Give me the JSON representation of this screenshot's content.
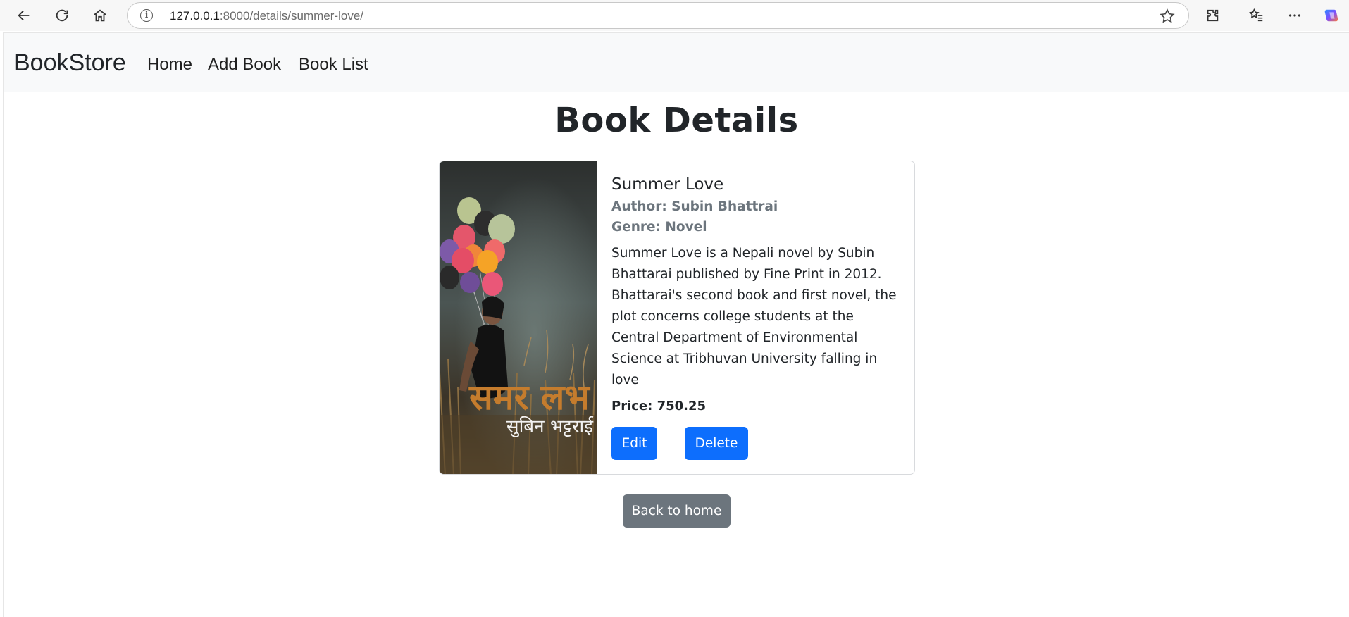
{
  "browser": {
    "url_host": "127.0.0.1",
    "url_path": ":8000/details/summer-love/"
  },
  "navbar": {
    "brand": "BookStore",
    "links": [
      "Home",
      "Add Book",
      "Book List"
    ]
  },
  "page": {
    "title": "Book Details"
  },
  "book": {
    "title": "Summer Love",
    "author": "Author: Subin Bhattrai",
    "genre": "Genre: Novel",
    "description": "Summer Love is a Nepali novel by Subin Bhattarai published by Fine Print in 2012. Bhattarai's second book and first novel, the plot concerns college students at the Central Department of Environmental Science at Tribhuvan University falling in love",
    "price": "Price: 750.25",
    "cover_title": "समर लभ",
    "cover_author": "सुबिन भट्टराई"
  },
  "actions": {
    "edit": "Edit",
    "delete": "Delete",
    "back": "Back to home"
  },
  "colors": {
    "primary": "#0d6efd",
    "secondary": "#6c757d",
    "navbar_bg": "#f8f9fa"
  }
}
